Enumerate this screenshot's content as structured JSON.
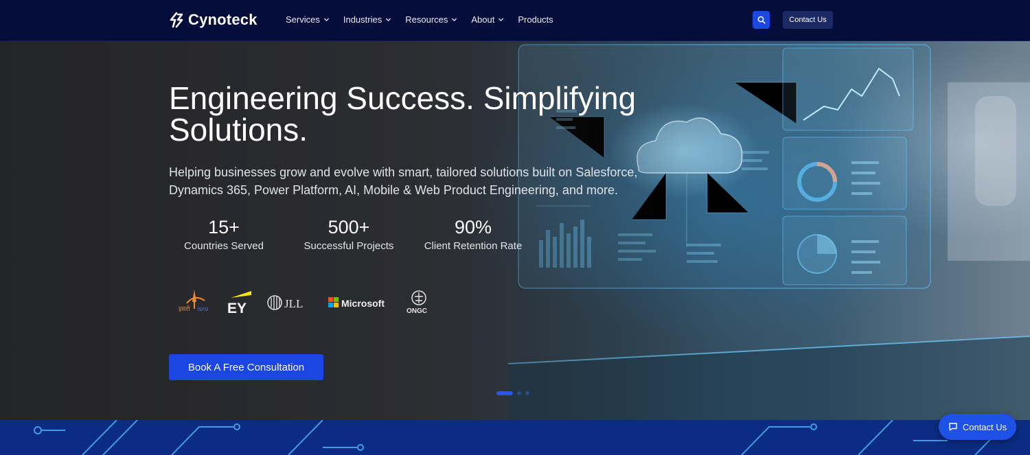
{
  "brand": {
    "name": "Cynoteck"
  },
  "nav": {
    "items": [
      {
        "label": "Services",
        "has_dropdown": true
      },
      {
        "label": "Industries",
        "has_dropdown": true
      },
      {
        "label": "Resources",
        "has_dropdown": true
      },
      {
        "label": "About",
        "has_dropdown": true
      },
      {
        "label": "Products",
        "has_dropdown": false
      }
    ],
    "search_icon": "search-icon",
    "contact_label": "Contact Us"
  },
  "hero": {
    "title": "Engineering Success. Simplifying Solutions.",
    "subtitle": "Helping businesses grow and evolve with smart, tailored solutions built on Salesforce, Dynamics 365, Power Platform, AI, Mobile & Web Product Engineering, and more.",
    "stats": [
      {
        "value": "15+",
        "label": "Countries Served"
      },
      {
        "value": "500+",
        "label": "Successful Projects"
      },
      {
        "value": "90%",
        "label": "Client Retention Rate"
      }
    ],
    "client_logos": [
      {
        "name": "isro",
        "text": "इसरो isro"
      },
      {
        "name": "ey",
        "text": "EY"
      },
      {
        "name": "jll",
        "text": "JLL"
      },
      {
        "name": "microsoft",
        "text": "Microsoft"
      },
      {
        "name": "ongc",
        "text": "ONGC"
      }
    ],
    "cta_label": "Book A Free Consultation",
    "carousel": {
      "active_index": 0,
      "count": 3
    }
  },
  "floating_contact": {
    "label": "Contact Us",
    "icon": "chat-icon"
  },
  "colors": {
    "nav_bg": "#050d3a",
    "accent": "#1b47e0",
    "contact_btn_bg": "#1c2a63",
    "band_bg": "#0c2c82"
  }
}
